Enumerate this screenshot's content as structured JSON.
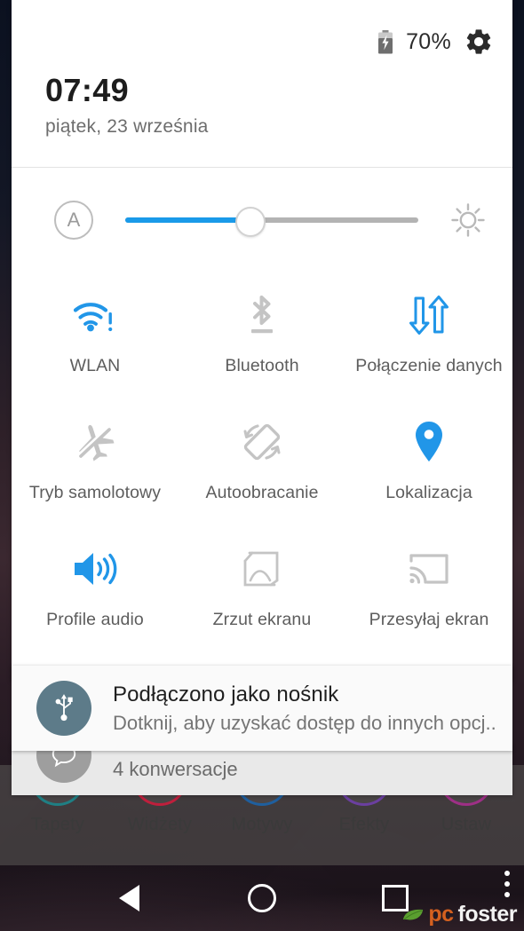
{
  "status_bar": {
    "battery_icon": "battery-charging-icon",
    "battery_percent": "70%",
    "settings_icon": "gear-icon"
  },
  "header": {
    "time": "07:49",
    "date": "piątek, 23 września"
  },
  "brightness": {
    "auto_icon": "auto-brightness-icon",
    "auto_label": "A",
    "level_percent": 42,
    "brightness_icon": "brightness-sun-icon",
    "fill_color": "#1a9ae9"
  },
  "tiles": [
    {
      "label": "WLAN",
      "icon": "wifi-icon",
      "state": "on",
      "color": "#2196e8"
    },
    {
      "label": "Bluetooth",
      "icon": "bluetooth-icon",
      "state": "off",
      "color": "#c4c4c4"
    },
    {
      "label": "Połączenie danych",
      "icon": "mobile-data-icon",
      "state": "on",
      "color": "#2196e8"
    },
    {
      "label": "Tryb samolotowy",
      "icon": "airplane-icon",
      "state": "off",
      "color": "#c4c4c4"
    },
    {
      "label": "Autoobracanie",
      "icon": "auto-rotate-icon",
      "state": "off",
      "color": "#c4c4c4"
    },
    {
      "label": "Lokalizacja",
      "icon": "location-pin-icon",
      "state": "on",
      "color": "#2196e8"
    },
    {
      "label": "Profile audio",
      "icon": "volume-speaker-icon",
      "state": "on",
      "color": "#2196e8"
    },
    {
      "label": "Zrzut ekranu",
      "icon": "screenshot-icon",
      "state": "off",
      "color": "#c4c4c4"
    },
    {
      "label": "Przesyłaj ekran",
      "icon": "cast-screen-icon",
      "state": "off",
      "color": "#c4c4c4"
    }
  ],
  "notifications": [
    {
      "icon": "usb-icon",
      "avatar_color": "#5d7b89",
      "title": "Podłączono jako nośnik",
      "subtitle": "Dotknij, aby uzyskać dostęp do innych opcj.."
    },
    {
      "icon": "message-bubble-icon",
      "avatar_color": "#9e9e9e",
      "title": "4 konwersacje"
    }
  ],
  "home_editor": [
    {
      "label": "Tapety",
      "color": "#1f7f84"
    },
    {
      "label": "Widżety",
      "color": "#bf1f3c"
    },
    {
      "label": "Motywy",
      "color": "#1f5f9e"
    },
    {
      "label": "Efekty",
      "color": "#6b3fa0"
    },
    {
      "label": "Ustaw",
      "color": "#9e2f86"
    }
  ],
  "navbar": {
    "back": "back-icon",
    "home": "home-icon",
    "recents": "recents-icon",
    "menu": "overflow-menu-icon"
  },
  "watermark": {
    "part1": "pc",
    "part2": "foster"
  }
}
